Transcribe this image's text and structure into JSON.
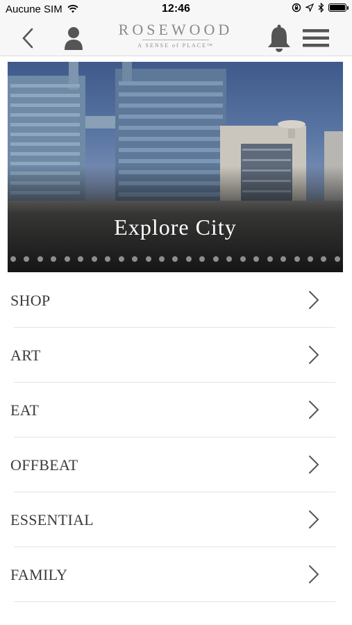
{
  "status_bar": {
    "carrier": "Aucune SIM",
    "time": "12:46",
    "battery_level": 1.0
  },
  "nav": {
    "brand_name": "ROSEWOOD",
    "brand_tagline": "A SENSE of PLACE™",
    "icons": [
      "chevron-left-icon",
      "user-icon",
      "bell-icon",
      "hamburger-menu-icon"
    ]
  },
  "hero": {
    "title": "Explore City",
    "dot_count": 25
  },
  "menu": {
    "items": [
      {
        "label": "SHOP"
      },
      {
        "label": "ART"
      },
      {
        "label": "EAT"
      },
      {
        "label": "OFFBEAT"
      },
      {
        "label": "ESSENTIAL"
      },
      {
        "label": "FAMILY"
      }
    ]
  },
  "colors": {
    "nav_background": "#f7f7f7",
    "text": "#3c3c3c",
    "icon_gray": "#555555",
    "brand_gray": "#8a8a8a"
  }
}
